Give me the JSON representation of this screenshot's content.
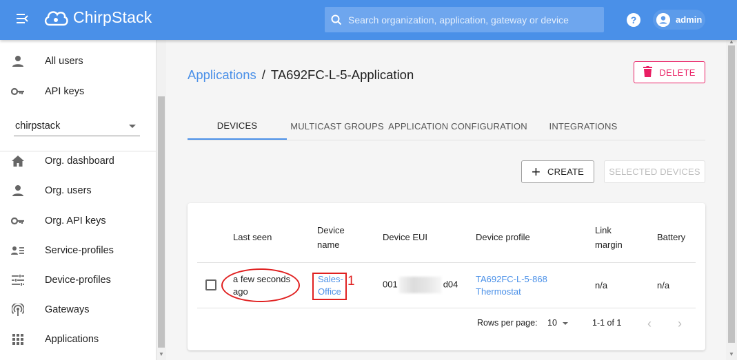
{
  "header": {
    "app_name": "ChirpStack",
    "search_placeholder": "Search organization, application, gateway or device",
    "user": "admin"
  },
  "sidebar": {
    "top_items": [
      {
        "label": "All users",
        "icon": "person-icon"
      },
      {
        "label": "API keys",
        "icon": "key-icon"
      }
    ],
    "org_selected": "chirpstack",
    "org_items": [
      {
        "label": "Org. dashboard",
        "icon": "home-icon"
      },
      {
        "label": "Org. users",
        "icon": "person-icon"
      },
      {
        "label": "Org. API keys",
        "icon": "key-icon"
      },
      {
        "label": "Service-profiles",
        "icon": "account-details-icon"
      },
      {
        "label": "Device-profiles",
        "icon": "tune-icon"
      },
      {
        "label": "Gateways",
        "icon": "radio-tower-icon"
      },
      {
        "label": "Applications",
        "icon": "apps-icon"
      }
    ]
  },
  "breadcrumb": {
    "parent": "Applications",
    "separator": "/",
    "current": "TA692FC-L-5-Application"
  },
  "actions": {
    "delete": "DELETE",
    "create": "CREATE",
    "selected_devices": "SELECTED DEVICES"
  },
  "tabs": [
    "DEVICES",
    "MULTICAST GROUPS",
    "APPLICATION CONFIGURATION",
    "INTEGRATIONS"
  ],
  "table": {
    "headers": {
      "last_seen": "Last seen",
      "device_name_1": "Device",
      "device_name_2": "name",
      "device_eui": "Device EUI",
      "device_profile": "Device profile",
      "link_margin_1": "Link",
      "link_margin_2": "margin",
      "battery": "Battery"
    },
    "rows": [
      {
        "last_seen_1": "a few seconds",
        "last_seen_2": "ago",
        "device_name_1": "Sales-",
        "device_name_2": "Office",
        "eui_prefix": "001",
        "eui_suffix": "d04",
        "profile_1": "TA692FC-L-5-868",
        "profile_2": "Thermostat",
        "link_margin": "n/a",
        "battery": "n/a"
      }
    ],
    "annotation_number": "1",
    "footer": {
      "rows_per_page_label": "Rows per page:",
      "rows_per_page": "10",
      "range": "1-1 of 1"
    }
  },
  "colors": {
    "primary": "#4a90e8",
    "danger": "#e91e63",
    "annotation": "#e02020"
  }
}
